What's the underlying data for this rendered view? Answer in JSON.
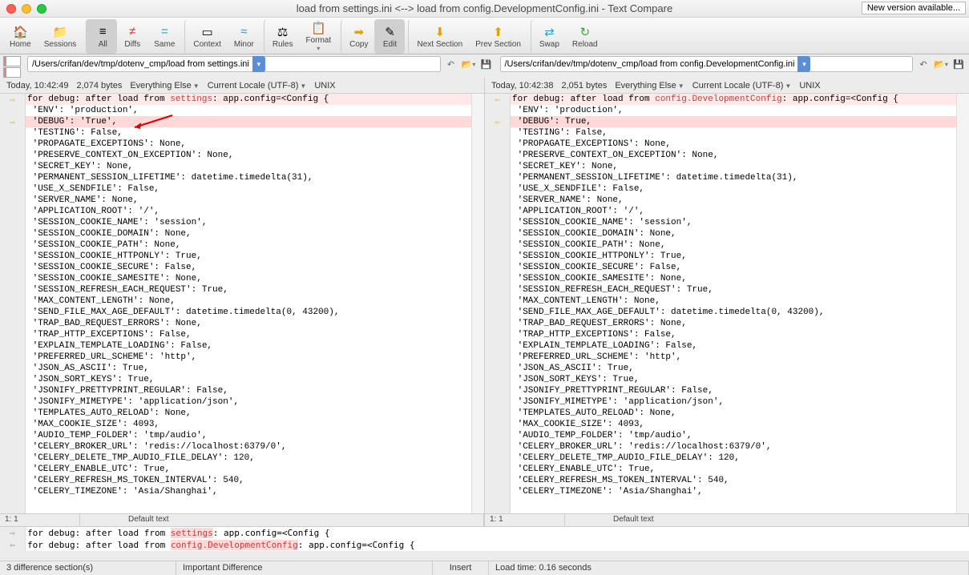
{
  "title": "load from settings.ini <--> load from config.DevelopmentConfig.ini - Text Compare",
  "new_version": "New version available...",
  "toolbar": {
    "home": "Home",
    "sessions": "Sessions",
    "all": "All",
    "diffs": "Diffs",
    "same": "Same",
    "context": "Context",
    "minor": "Minor",
    "rules": "Rules",
    "format": "Format",
    "copy": "Copy",
    "edit": "Edit",
    "next": "Next Section",
    "prev": "Prev Section",
    "swap": "Swap",
    "reload": "Reload"
  },
  "left": {
    "path": "/Users/crifan/dev/tmp/dotenv_cmp/load from settings.ini",
    "time": "Today, 10:42:49",
    "bytes": "2,074 bytes",
    "filter": "Everything Else",
    "enc": "Current Locale (UTF-8)",
    "eol": "UNIX",
    "pos": "1: 1",
    "enc2": "Default text",
    "first": "for debug: after load from settings: app.config=<Config {",
    "debug": " 'DEBUG': 'True',"
  },
  "right": {
    "path": "/Users/crifan/dev/tmp/dotenv_cmp/load from config.DevelopmentConfig.ini",
    "time": "Today, 10:42:38",
    "bytes": "2,051 bytes",
    "filter": "Everything Else",
    "enc": "Current Locale (UTF-8)",
    "eol": "UNIX",
    "pos": "1: 1",
    "enc2": "Default text",
    "first": "for debug: after load from config.DevelopmentConfig: app.config=<Config {",
    "debug": " 'DEBUG': True,"
  },
  "code_rest": [
    " 'ENV': 'production',",
    "",
    " 'TESTING': False,",
    " 'PROPAGATE_EXCEPTIONS': None,",
    " 'PRESERVE_CONTEXT_ON_EXCEPTION': None,",
    " 'SECRET_KEY': None,",
    " 'PERMANENT_SESSION_LIFETIME': datetime.timedelta(31),",
    " 'USE_X_SENDFILE': False,",
    " 'SERVER_NAME': None,",
    " 'APPLICATION_ROOT': '/',",
    " 'SESSION_COOKIE_NAME': 'session',",
    " 'SESSION_COOKIE_DOMAIN': None,",
    " 'SESSION_COOKIE_PATH': None,",
    " 'SESSION_COOKIE_HTTPONLY': True,",
    " 'SESSION_COOKIE_SECURE': False,",
    " 'SESSION_COOKIE_SAMESITE': None,",
    " 'SESSION_REFRESH_EACH_REQUEST': True,",
    " 'MAX_CONTENT_LENGTH': None,",
    " 'SEND_FILE_MAX_AGE_DEFAULT': datetime.timedelta(0, 43200),",
    " 'TRAP_BAD_REQUEST_ERRORS': None,",
    " 'TRAP_HTTP_EXCEPTIONS': False,",
    " 'EXPLAIN_TEMPLATE_LOADING': False,",
    " 'PREFERRED_URL_SCHEME': 'http',",
    " 'JSON_AS_ASCII': True,",
    " 'JSON_SORT_KEYS': True,",
    " 'JSONIFY_PRETTYPRINT_REGULAR': False,",
    " 'JSONIFY_MIMETYPE': 'application/json',",
    " 'TEMPLATES_AUTO_RELOAD': None,",
    " 'MAX_COOKIE_SIZE': 4093,",
    " 'AUDIO_TEMP_FOLDER': 'tmp/audio',",
    " 'CELERY_BROKER_URL': 'redis://localhost:6379/0',",
    " 'CELERY_DELETE_TMP_AUDIO_FILE_DELAY': 120,",
    " 'CELERY_ENABLE_UTC': True,",
    " 'CELERY_REFRESH_MS_TOKEN_INTERVAL': 540,",
    " 'CELERY_TIMEZONE': 'Asia/Shanghai',"
  ],
  "summary": {
    "l1_pre": "for debug: after load from ",
    "l1_hl": "settings",
    "l1_post": ": app.config=<Config {",
    "l2_pre": "for debug: after load from ",
    "l2_hl": "config.DevelopmentConfig",
    "l2_post": ": app.config=<Config {"
  },
  "status": {
    "diff": "3 difference section(s)",
    "imp": "Important Difference",
    "ins": "Insert",
    "load": "Load time: 0.16 seconds"
  }
}
